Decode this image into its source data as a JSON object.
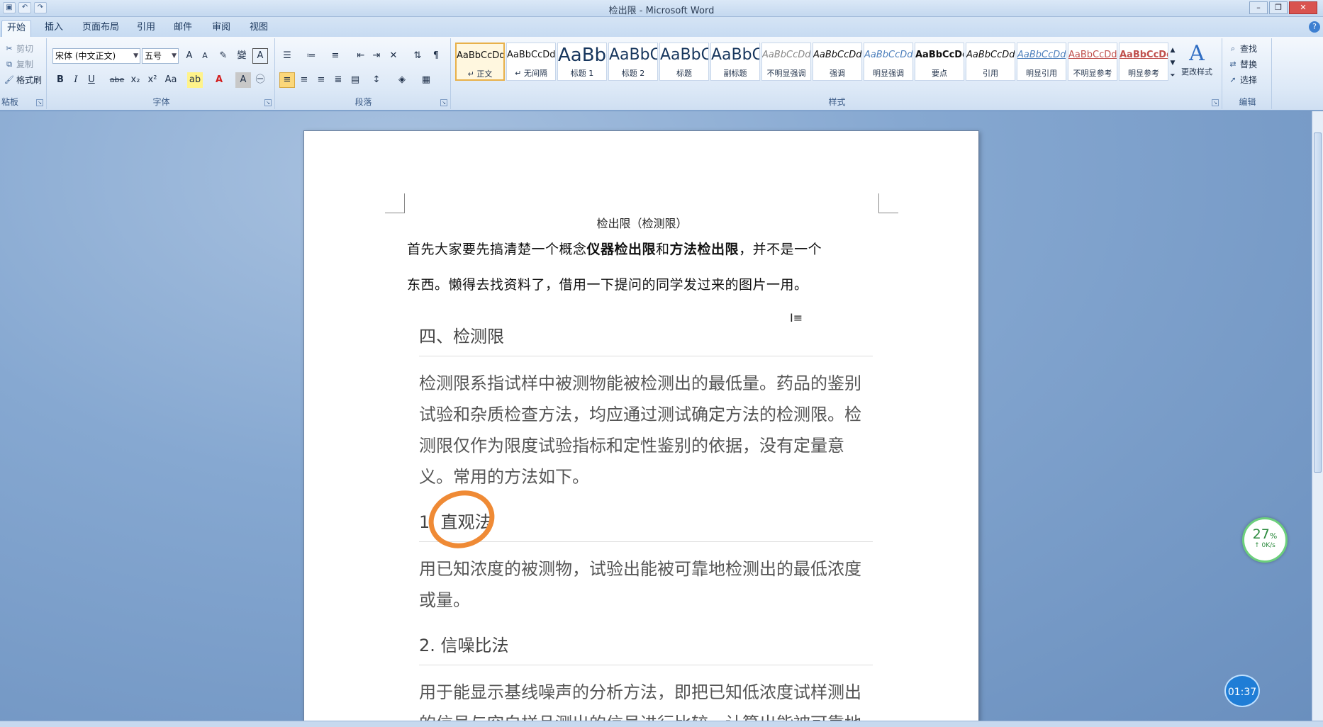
{
  "window": {
    "title": "检出限 - Microsoft Word",
    "buttons": {
      "minimize": "–",
      "restore": "❐",
      "close": "✕"
    },
    "help": "?"
  },
  "tabs": [
    "开始",
    "插入",
    "页面布局",
    "引用",
    "邮件",
    "审阅",
    "视图"
  ],
  "clipboard": {
    "cut": "剪切",
    "copy": "复制",
    "format_painter": "格式刷",
    "label": "粘板"
  },
  "font": {
    "name": "宋体 (中文正文)",
    "size": "五号",
    "label": "字体",
    "buttons": [
      "B",
      "I",
      "U",
      "abe",
      "x₂",
      "x²",
      "Aa"
    ]
  },
  "paragraph": {
    "label": "段落"
  },
  "styles": {
    "label": "样式",
    "items": [
      {
        "sample": "AaBbCcDd",
        "name": "↵ 正文"
      },
      {
        "sample": "AaBbCcDd",
        "name": "↵ 无间隔"
      },
      {
        "sample": "AaBb",
        "name": "标题 1"
      },
      {
        "sample": "AaBbC",
        "name": "标题 2"
      },
      {
        "sample": "AaBbC",
        "name": "标题"
      },
      {
        "sample": "AaBbC",
        "name": "副标题"
      },
      {
        "sample": "AaBbCcDd",
        "name": "不明显强调"
      },
      {
        "sample": "AaBbCcDd",
        "name": "强调"
      },
      {
        "sample": "AaBbCcDd",
        "name": "明显强调"
      },
      {
        "sample": "AaBbCcDd",
        "name": "要点"
      },
      {
        "sample": "AaBbCcDd",
        "name": "引用"
      },
      {
        "sample": "AaBbCcDd",
        "name": "明显引用"
      },
      {
        "sample": "AaBbCcDd",
        "name": "不明显参考"
      },
      {
        "sample": "AaBbCcDd",
        "name": "明显参考"
      }
    ],
    "change_styles": "更改样式"
  },
  "editing": {
    "find": "查找",
    "replace": "替换",
    "select": "选择",
    "label": "编辑"
  },
  "document": {
    "title": "检出限（检测限）",
    "para1_a": "首先大家要先搞清楚一个概念",
    "para1_b1": "仪器检出限",
    "para1_c": "和",
    "para1_b2": "方法检出限",
    "para1_d": "，并不是一个",
    "para2": "东西。懒得去找资料了，借用一下提问的同学发过来的图片一用。",
    "image": {
      "h1": "四、检测限",
      "body1": "检测限系指试样中被测物能被检测出的最低量。药品的鉴别试验和杂质检查方法，均应通过测试确定方法的检测限。检测限仅作为限度试验指标和定性鉴别的依据，没有定量意义。常用的方法如下。",
      "h2": "1. 直观法",
      "body2": "用已知浓度的被测物，试验出能被可靠地检测出的最低浓度或量。",
      "h3": "2. 信噪比法",
      "body3": "用于能显示基线噪声的分析方法，即把已知低浓度试样测出的信号与空白样品测出的信号进行比较，计算出能被可靠地"
    }
  },
  "overlay": {
    "speed_pct": "27",
    "speed_unit": "%",
    "speed_rate": "↑ 0K/s",
    "timer": "01:37"
  },
  "colors": {
    "accent": "#ef8a35",
    "ribbon": "#dde9f7"
  }
}
